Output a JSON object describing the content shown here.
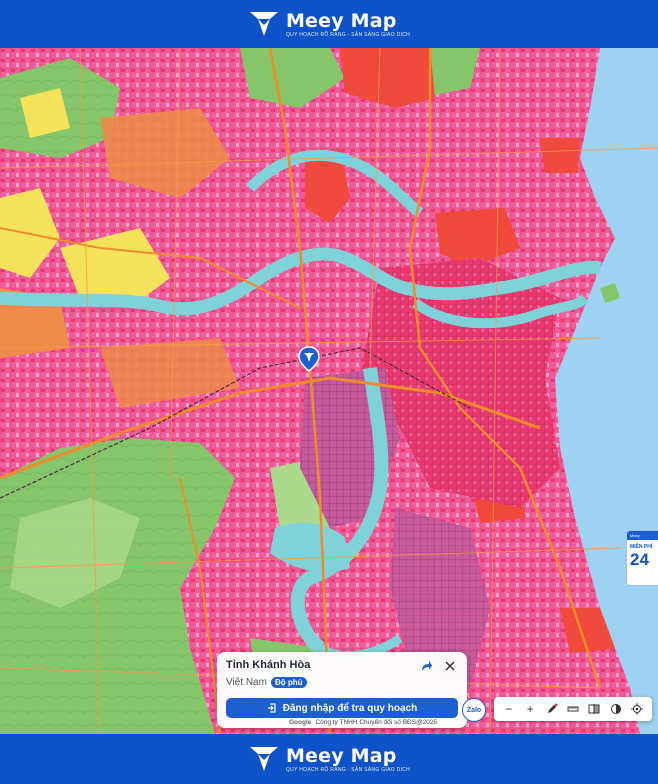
{
  "brand": {
    "name": "Meey Map",
    "tagline": "QUY HOẠCH RÕ RÀNG - SẴN SÀNG GIAO DỊCH",
    "logo_icon": "meey-logo-icon"
  },
  "map": {
    "location_pin": "map-pin-icon",
    "colors": {
      "residential": "#f25c9a",
      "urban_dense": "#e8386e",
      "pink_light": "#f7a4c8",
      "orange_zone": "#ee8a4a",
      "red_zone": "#ef4a3b",
      "green": "#86c66b",
      "green_light": "#a9d98a",
      "yellow": "#f4e35a",
      "water": "#a8dcf0",
      "river": "#7fd3d8",
      "sea": "#9fd1f2",
      "road": "#f08a2b"
    }
  },
  "promo": {
    "head": "Meey",
    "subtitle": "MIỄN PHÍ",
    "number": "24"
  },
  "info_card": {
    "title": "Tỉnh Khánh Hòa",
    "country": "Việt Nam",
    "coverage_badge": "Độ phủ",
    "login_button": "Đăng nhập để tra quy hoạch"
  },
  "attribution": {
    "provider": "Google",
    "text": "Công ty TNHH Chuyển đổi số BĐS@2025"
  },
  "zalo": "Zalo",
  "toolbar": {
    "zoom_out": "−",
    "zoom_in": "+",
    "tools": [
      "zoom-out-icon",
      "zoom-in-icon",
      "draw-icon",
      "ruler-icon",
      "compare-icon",
      "layers-icon",
      "locate-icon"
    ]
  }
}
